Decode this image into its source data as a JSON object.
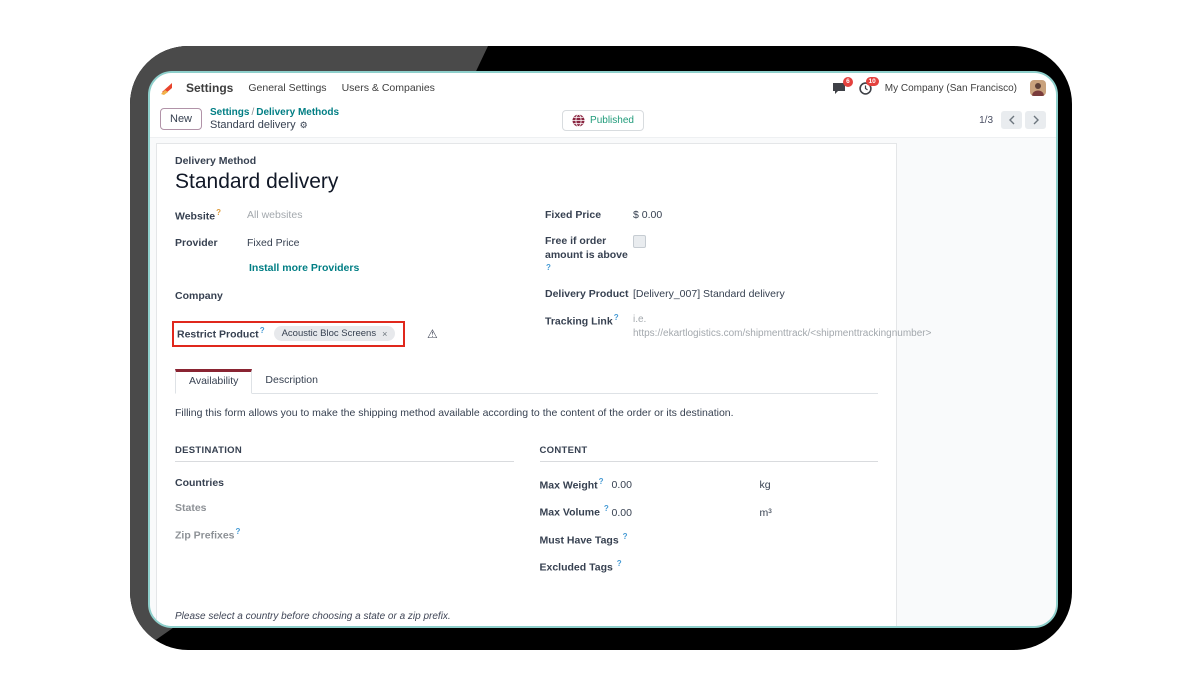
{
  "navbar": {
    "app_name": "Settings",
    "menus": [
      "General Settings",
      "Users & Companies"
    ],
    "messages_badge": "6",
    "activities_badge": "10",
    "company": "My Company (San Francisco)"
  },
  "control_panel": {
    "new_button": "New",
    "breadcrumb": {
      "root": "Settings",
      "separator": "/",
      "section": "Delivery Methods"
    },
    "record_name": "Standard delivery",
    "status": "Published",
    "pager": "1/3"
  },
  "icons": {
    "gear": "⚙",
    "warning": "⚠",
    "remove": "×",
    "help": "?"
  },
  "form": {
    "title_label": "Delivery Method",
    "title": "Standard delivery",
    "fields": {
      "website": {
        "label": "Website",
        "value": "All websites"
      },
      "provider": {
        "label": "Provider",
        "value": "Fixed Price"
      },
      "install_link": "Install more Providers",
      "company": {
        "label": "Company",
        "value": ""
      },
      "restrict_product": {
        "label": "Restrict Product",
        "tag": "Acoustic Bloc Screens"
      },
      "fixed_price": {
        "label": "Fixed Price",
        "value": "$ 0.00"
      },
      "free_if": {
        "label": "Free if order amount is above"
      },
      "delivery_product": {
        "label": "Delivery Product",
        "value": "[Delivery_007] Standard delivery"
      },
      "tracking_link": {
        "label": "Tracking Link",
        "placeholder": "i.e. https://ekartlogistics.com/shipmenttrack/<shipmenttrackingnumber>"
      }
    },
    "tabs": [
      "Availability",
      "Description"
    ],
    "tab_info": "Filling this form allows you to make the shipping method available according to the content of the order or its destination.",
    "destination": {
      "header": "DESTINATION",
      "countries": "Countries",
      "states": "States",
      "zip_prefixes": "Zip Prefixes"
    },
    "content": {
      "header": "CONTENT",
      "max_weight": {
        "label": "Max Weight",
        "value": "0.00",
        "unit": "kg"
      },
      "max_volume": {
        "label": "Max Volume",
        "value": "0.00",
        "unit": "m³"
      },
      "must_have_tags": "Must Have Tags",
      "excluded_tags": "Excluded Tags"
    },
    "note": "Please select a country before choosing a state or a zip prefix."
  },
  "colors": {
    "teal_link": "#017e84",
    "annotation_red": "#e0281c",
    "badge_red": "#e4413e",
    "active_tab_maroon": "#8a2432"
  }
}
